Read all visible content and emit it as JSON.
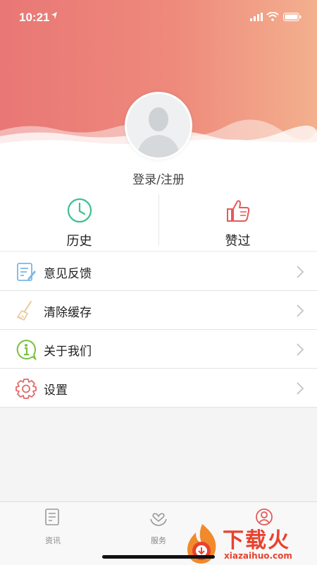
{
  "status_bar": {
    "time": "10:21"
  },
  "profile": {
    "login_label": "登录/注册"
  },
  "quick_actions": [
    {
      "label": "历史",
      "icon": "clock-icon",
      "color": "#3cc08f"
    },
    {
      "label": "赞过",
      "icon": "thumbs-up-icon",
      "color": "#e45a57"
    }
  ],
  "menu": [
    {
      "label": "意见反馈",
      "icon": "feedback-icon"
    },
    {
      "label": "清除缓存",
      "icon": "broom-icon"
    },
    {
      "label": "关于我们",
      "icon": "info-icon"
    },
    {
      "label": "设置",
      "icon": "gear-icon"
    }
  ],
  "tabs": [
    {
      "label": "资讯",
      "icon": "news-icon"
    },
    {
      "label": "服务",
      "icon": "heart-hands-icon"
    },
    {
      "label": "",
      "icon": "user-icon",
      "active": true
    }
  ],
  "watermark": {
    "brand": "下载火",
    "url": "xiazaihuo.com"
  },
  "colors": {
    "header_start": "#e97775",
    "header_end": "#f3b08e",
    "accent": "#e45a57"
  }
}
